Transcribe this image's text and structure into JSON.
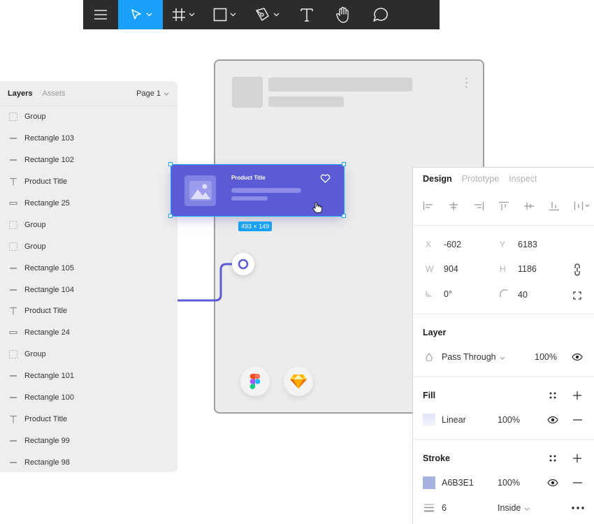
{
  "toolbar": {
    "items": [
      {
        "icon": "menu-icon"
      },
      {
        "icon": "move-tool-icon",
        "active": true
      },
      {
        "icon": "frame-tool-icon"
      },
      {
        "icon": "rectangle-tool-icon"
      },
      {
        "icon": "pen-tool-icon"
      },
      {
        "icon": "text-tool-icon"
      },
      {
        "icon": "hand-tool-icon"
      },
      {
        "icon": "comment-tool-icon"
      }
    ],
    "active_color": "#18a0fb",
    "bg_color": "#2c2c2c"
  },
  "layers_panel": {
    "tab_layers": "Layers",
    "tab_assets": "Assets",
    "page_label": "Page 1",
    "items": [
      {
        "name": "Group",
        "icon": "group-icon"
      },
      {
        "name": "Rectangle 103",
        "icon": "line-icon"
      },
      {
        "name": "Rectangle 102",
        "icon": "line-icon"
      },
      {
        "name": "Product Title",
        "icon": "text-icon"
      },
      {
        "name": "Rectangle 25",
        "icon": "rectangle-icon"
      },
      {
        "name": "Group",
        "icon": "group-icon"
      },
      {
        "name": "Group",
        "icon": "group-icon"
      },
      {
        "name": "Rectangle 105",
        "icon": "line-icon"
      },
      {
        "name": "Rectangle 104",
        "icon": "line-icon"
      },
      {
        "name": "Product Title",
        "icon": "text-icon"
      },
      {
        "name": "Rectangle 24",
        "icon": "rectangle-icon"
      },
      {
        "name": "Group",
        "icon": "group-icon"
      },
      {
        "name": "Rectangle 101",
        "icon": "line-icon"
      },
      {
        "name": "Rectangle 100",
        "icon": "line-icon"
      },
      {
        "name": "Product Title",
        "icon": "text-icon"
      },
      {
        "name": "Rectangle 99",
        "icon": "line-icon"
      },
      {
        "name": "Rectangle 98",
        "icon": "line-icon"
      }
    ]
  },
  "canvas": {
    "card": {
      "title": "Product Title",
      "bg_color": "#5b5bd6",
      "size_label": "493 × 149"
    },
    "connector_color": "#5b5bd6",
    "logos": [
      "figma-logo",
      "sketch-logo"
    ]
  },
  "design_panel": {
    "tabs": [
      "Design",
      "Prototype",
      "Inspect"
    ],
    "x_label": "X",
    "x": "-602",
    "y_label": "Y",
    "y": "6183",
    "w_label": "W",
    "w": "904",
    "h_label": "H",
    "h": "1186",
    "rotation": "0°",
    "radius": "40",
    "layer": {
      "title": "Layer",
      "blend": "Pass Through",
      "opacity": "100%"
    },
    "fill": {
      "title": "Fill",
      "type": "Linear",
      "opacity": "100%"
    },
    "stroke": {
      "title": "Stroke",
      "color_hex": "A6B3E1",
      "swatch": "#a6b3e1",
      "opacity": "100%",
      "weight": "6",
      "position": "Inside"
    }
  }
}
